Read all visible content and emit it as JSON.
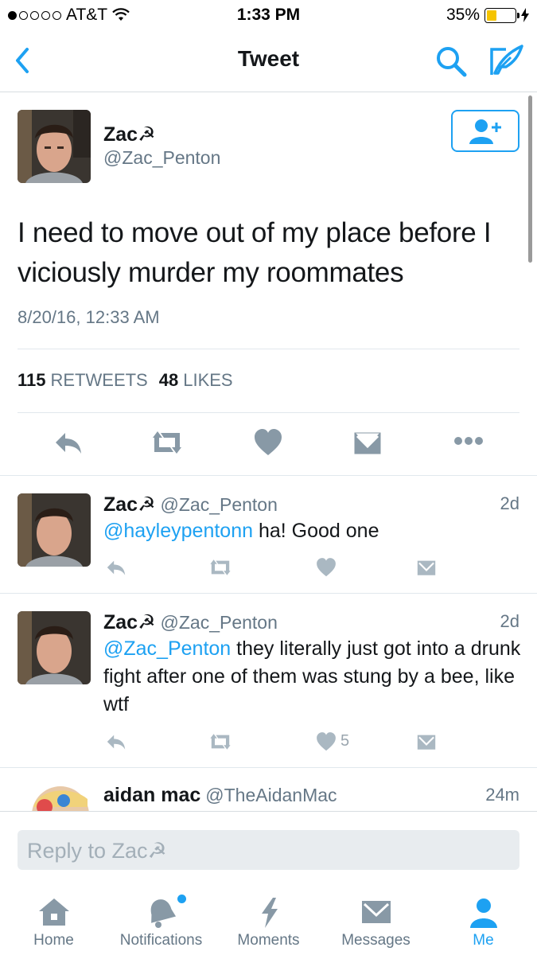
{
  "status_bar": {
    "carrier": "AT&T",
    "time": "1:33 PM",
    "battery": "35%"
  },
  "nav": {
    "title": "Tweet"
  },
  "tweet": {
    "author_name": "Zac☭",
    "author_handle": "@Zac_Penton",
    "text": "I need to move out of my place before I viciously murder my roommates",
    "date": "8/20/16, 12:33 AM",
    "retweets_count": "115",
    "retweets_label": "RETWEETS",
    "likes_count": "48",
    "likes_label": "LIKES"
  },
  "replies": [
    {
      "name": "Zac☭",
      "handle": "@Zac_Penton",
      "time": "2d",
      "mention": "@hayleypentonn",
      "text": " ha! Good one",
      "likes": ""
    },
    {
      "name": "Zac☭",
      "handle": "@Zac_Penton",
      "time": "2d",
      "mention": "@Zac_Penton",
      "text": " they literally just got into a drunk fight after one of them was stung by a bee, like wtf",
      "likes": "5"
    },
    {
      "name": "aidan mac",
      "handle": "@TheAidanMac",
      "time": "24m"
    }
  ],
  "reply_bar": {
    "placeholder": "Reply to Zac☭"
  },
  "tabs": [
    {
      "label": "Home",
      "icon": "home-icon"
    },
    {
      "label": "Notifications",
      "icon": "bell-icon"
    },
    {
      "label": "Moments",
      "icon": "lightning-icon"
    },
    {
      "label": "Messages",
      "icon": "envelope-icon"
    },
    {
      "label": "Me",
      "icon": "person-icon",
      "active": true
    }
  ],
  "colors": {
    "accent": "#1da1f2",
    "muted": "#657786",
    "icon_gray": "#aab8c2"
  }
}
